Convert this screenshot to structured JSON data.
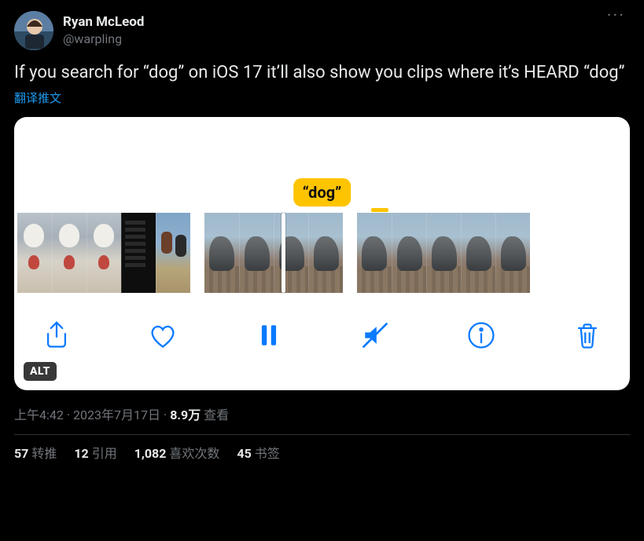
{
  "author": {
    "display_name": "Ryan McLeod",
    "handle": "@warpling"
  },
  "more_label": "···",
  "body_text": "If you search for “dog” on iOS 17 it’ll also show you clips where it’s HEARD “dog”",
  "translate_label": "翻译推文",
  "media": {
    "caption_tag": "“dog”",
    "alt_badge": "ALT",
    "toolbar_icons": {
      "share": "share-icon",
      "like": "heart-icon",
      "pause": "pause-icon",
      "mute": "mute-icon",
      "info": "info-icon",
      "trash": "trash-icon"
    }
  },
  "meta": {
    "time": "上午4:42",
    "date": "2023年7月17日",
    "views_count": "8.9万",
    "views_label": "查看"
  },
  "engagement": {
    "retweets": {
      "count": "57",
      "label": "转推"
    },
    "quotes": {
      "count": "12",
      "label": "引用"
    },
    "likes": {
      "count": "1,082",
      "label": "喜欢次数"
    },
    "bookmarks": {
      "count": "45",
      "label": "书签"
    }
  }
}
